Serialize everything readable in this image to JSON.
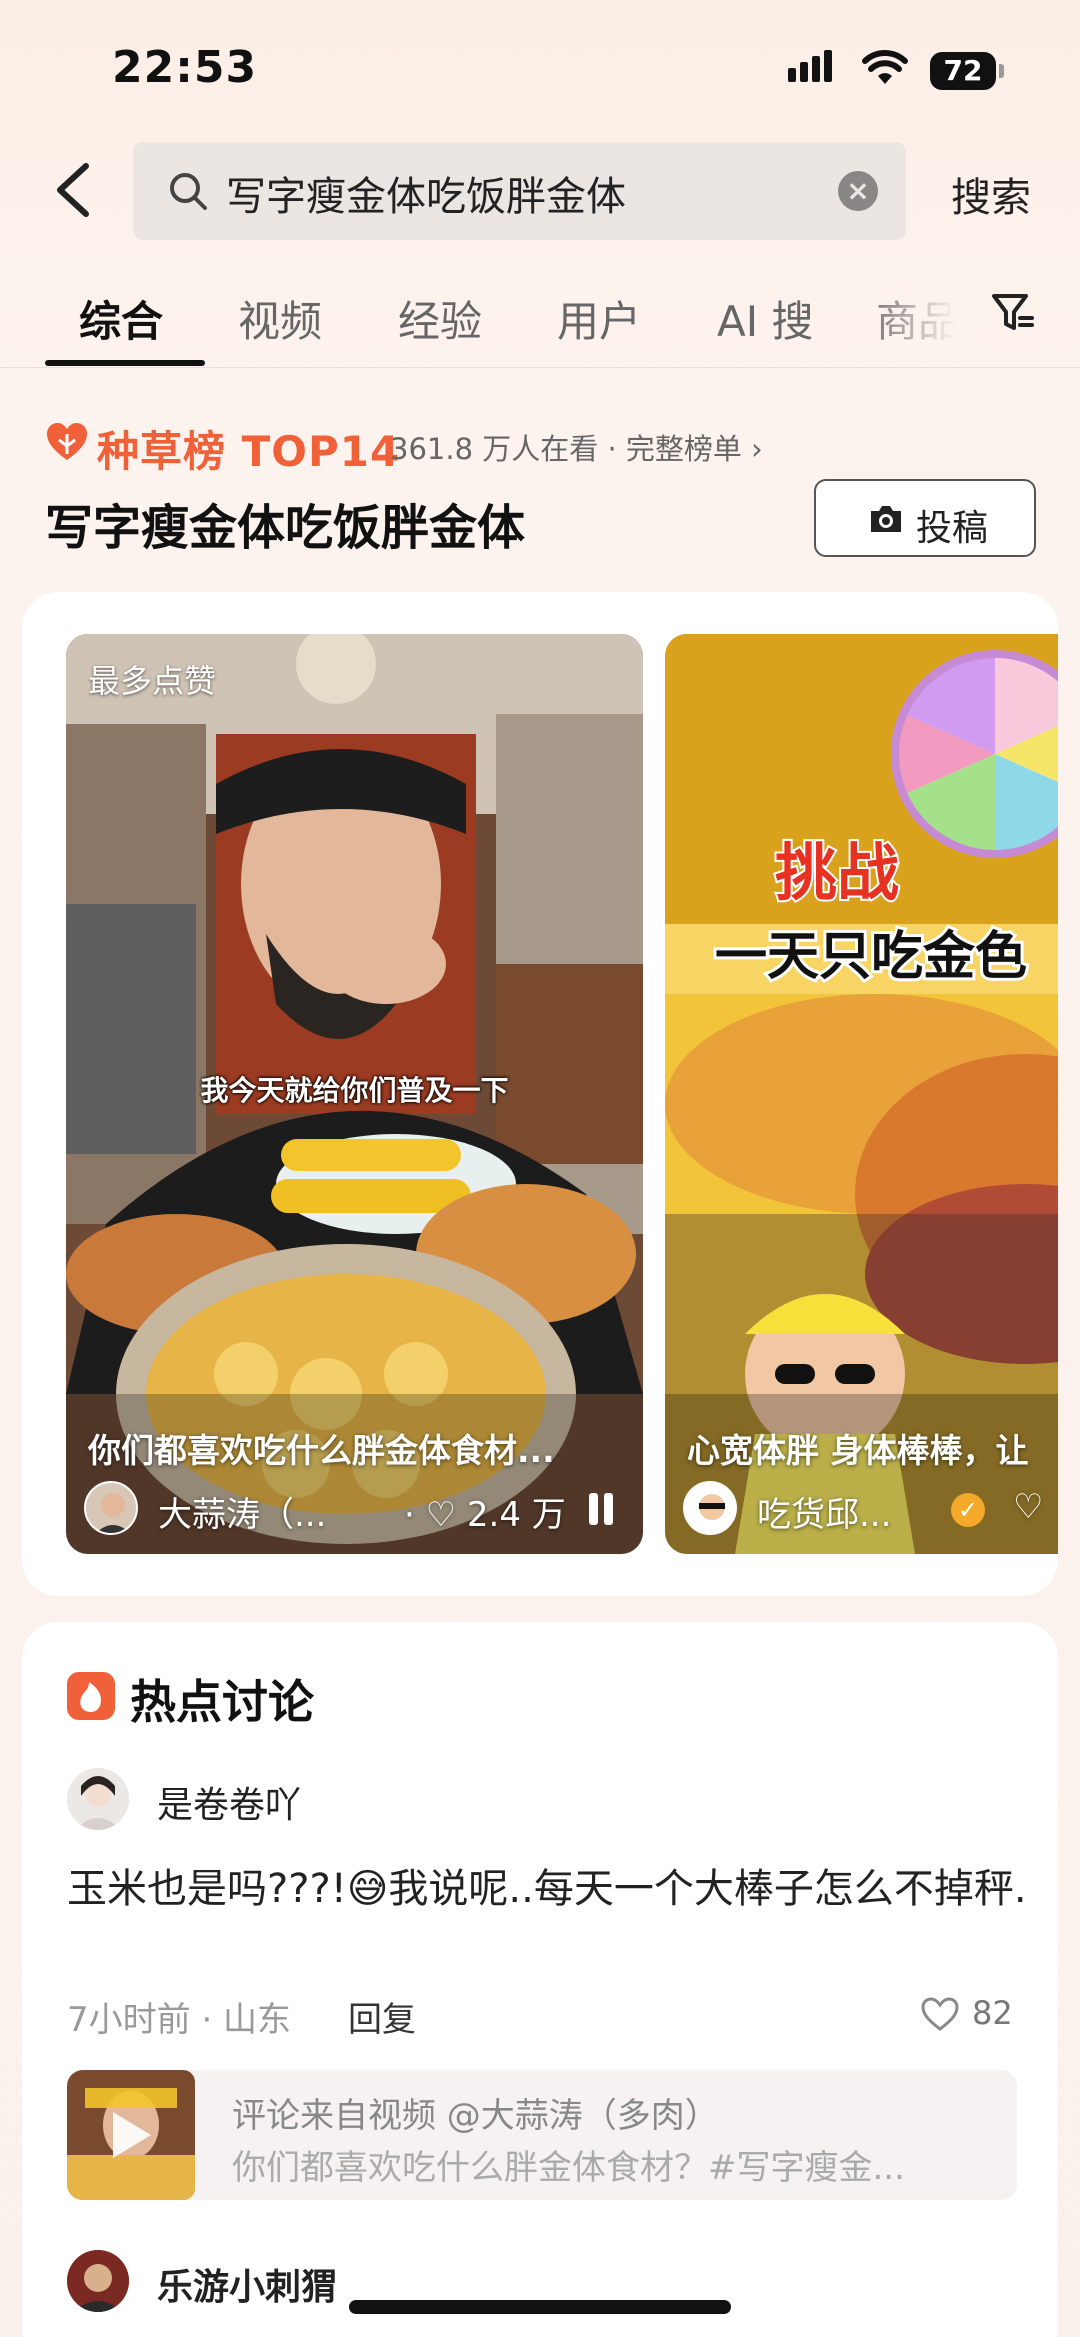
{
  "status_bar": {
    "time": "22:53",
    "battery": "72"
  },
  "search": {
    "query": "写字瘦金体吃饭胖金体",
    "clear_icon": "clear-icon",
    "submit_label": "搜索"
  },
  "tabs": [
    {
      "label": "综合",
      "active": true
    },
    {
      "label": "视频",
      "active": false
    },
    {
      "label": "经验",
      "active": false
    },
    {
      "label": "用户",
      "active": false
    },
    {
      "label": "AI 搜",
      "active": false
    },
    {
      "label": "商品",
      "active": false
    }
  ],
  "ranking": {
    "title": "种草榜 TOP14",
    "meta": "361.8 万人在看 · 完整榜单 ›",
    "topic": "写字瘦金体吃饭胖金体",
    "submit_label": "投稿",
    "accent_color": "#f0613a"
  },
  "videos": [
    {
      "badge": "最多点赞",
      "subtitle": "我今天就给你们普及一下",
      "description": "你们都喜欢吃什么胖金体食材...",
      "author": "大蒜涛（...",
      "likes": "· ♡ 2.4 万"
    },
    {
      "overlay_text_1": "挑战",
      "overlay_text_2": "一天只吃金色",
      "description": "心宽体胖 身体棒棒，让",
      "author": "吃货邱...",
      "likes": "♡"
    }
  ],
  "hot": {
    "title": "热点讨论",
    "comment": {
      "user": "是卷卷吖",
      "text": "玉米也是吗???!😅我说呢..每天一个大棒子怎么不掉秤.",
      "meta": "7小时前 · 山东",
      "reply_label": "回复",
      "likes": "82",
      "ref_line1": "评论来自视频 @大蒜涛（多肉）",
      "ref_line2": "你们都喜欢吃什么胖金体食材？#写字瘦金..."
    },
    "next_user": "乐游小刺猬"
  }
}
